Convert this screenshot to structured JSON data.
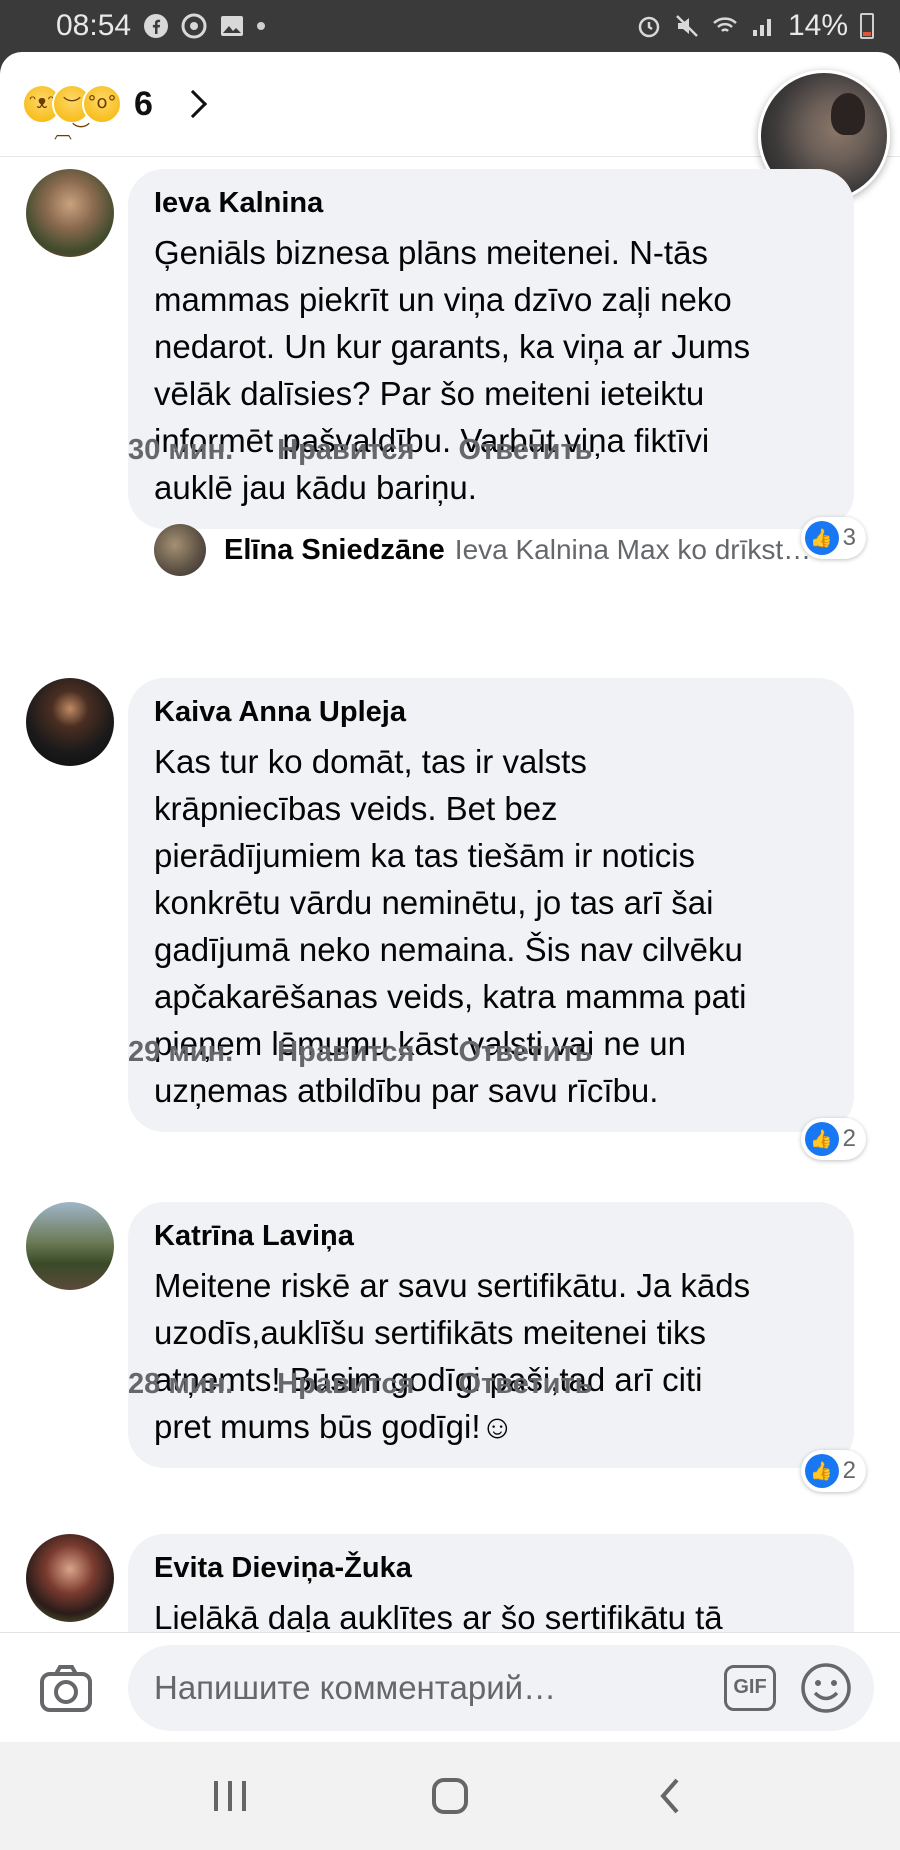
{
  "status_bar": {
    "time": "08:54",
    "battery": "14%"
  },
  "reactions": {
    "count": "6",
    "icons": [
      "laughing-reaction",
      "sad-reaction",
      "wow-reaction"
    ]
  },
  "comments": [
    {
      "author": "Ieva Kalnina",
      "text": "Ģeniāls biznesa plāns meitenei. N-tās\nmammas piekrīt un viņa dzīvo zaļi neko\nnedarot. Un kur garants, ka viņa ar Jums\nvēlāk dalīsies? Par šo meiteni ieteiktu\ninformēt pašvaldību. Varbūt viņa fiktīvi\nauklē jau kādu bariņu.",
      "time": "30 мин.",
      "like_label": "Нравится",
      "reply_label": "Ответить",
      "likes": "3"
    },
    {
      "author": "Kaiva Anna Upleja",
      "text": "Kas tur ko domāt, tas ir valsts\nkrāpniecības veids. Bet bez\npierādījumiem ka tas tiešām ir noticis\nkonkrētu vārdu neminētu, jo tas arī šai\ngadījumā neko nemaina. Šis nav cilvēku\napčakarēšanas veids, katra mamma pati\npieņem lēmumu kāst valsti vai ne un\nuzņemas atbildību par savu rīcību.",
      "time": "29 мин.",
      "like_label": "Нравится",
      "reply_label": "Ответить",
      "likes": "2"
    },
    {
      "author": "Katrīna Laviņa",
      "text": "Meitene riskē ar savu sertifikātu. Ja kāds\nuzodīs,auklīšu sertifikāts meitenei tiks\natņemts! Būsim godīgi paši,tad arī citi\npret mums būs godīgi!☺",
      "time": "28 мин.",
      "like_label": "Нравится",
      "reply_label": "Ответить",
      "likes": "2"
    },
    {
      "author": "Evita Dieviņa-Žuka",
      "text": "Lielākā daļa auklītes ar šo sertifikātu tā"
    }
  ],
  "reply_preview": {
    "author": "Elīna Sniedzāne",
    "text": "Ieva Kalnina Max ko drīkst…"
  },
  "composer": {
    "placeholder": "Напишите комментарий…",
    "gif_label": "GIF"
  }
}
